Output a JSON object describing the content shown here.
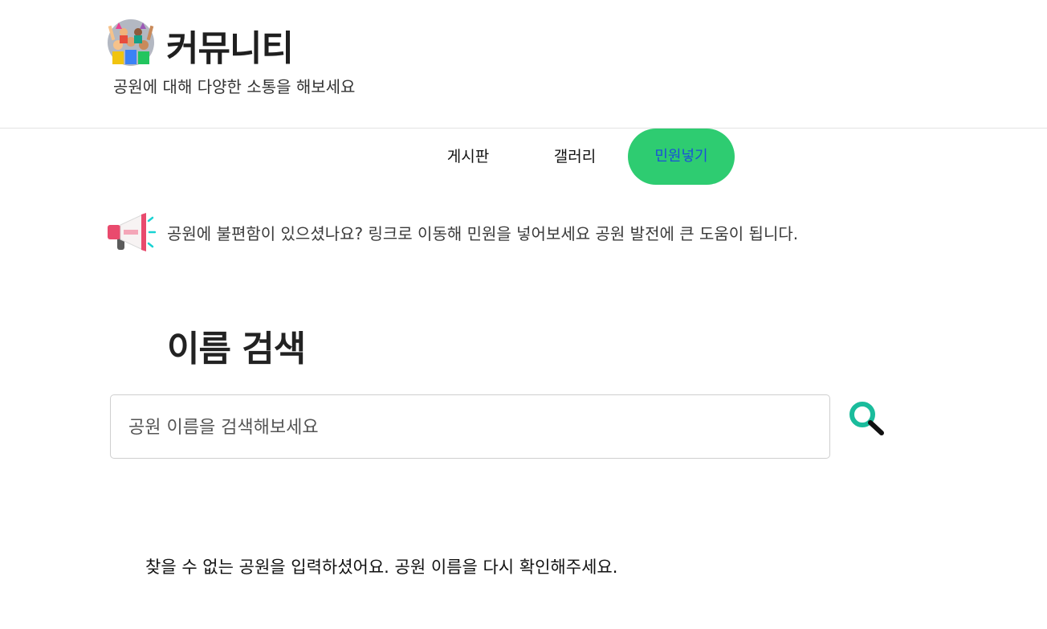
{
  "header": {
    "title": "커뮤니티",
    "subtitle": "공원에 대해 다양한 소통을 해보세요",
    "logo_icon": "community-people-icon"
  },
  "nav": {
    "items": [
      {
        "label": "게시판",
        "active": false
      },
      {
        "label": "갤러리",
        "active": false
      },
      {
        "label": "민원넣기",
        "active": true
      }
    ],
    "active_color": "#2ecc71",
    "active_text_color": "#1b4fd8"
  },
  "notice": {
    "icon": "megaphone-icon",
    "text": "공원에 불편함이 있으셨나요? 링크로 이동해 민원을 넣어보세요 공원 발전에 큰 도움이 됩니다."
  },
  "search": {
    "heading": "이름 검색",
    "placeholder": "공원 이름을 검색해보세요",
    "value": "",
    "button_icon": "search-icon",
    "button_color": "#1abc9c"
  },
  "result": {
    "message": "찾을 수 없는 공원을 입력하셨어요. 공원 이름을 다시 확인해주세요."
  }
}
